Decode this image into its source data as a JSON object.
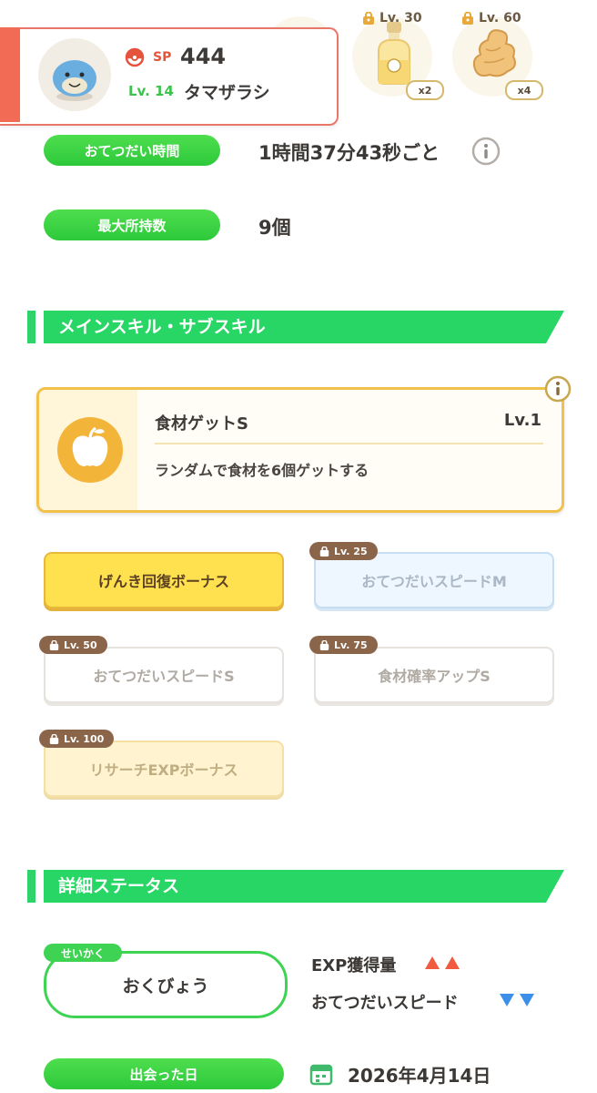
{
  "top_ingredients": [
    {
      "level": "Lv. 30",
      "qty": "x2",
      "icon": "oil-bottle-icon"
    },
    {
      "level": "Lv. 60",
      "qty": "x4",
      "icon": "ginger-icon"
    }
  ],
  "profile": {
    "sp_label": "SP",
    "sp_value": "444",
    "level": "Lv. 14",
    "name": "タマザラシ"
  },
  "stats": {
    "help_time_label": "おてつだい時間",
    "help_time_value": "1時間37分43秒ごと",
    "max_carry_label": "最大所持数",
    "max_carry_value": "9個"
  },
  "skills_section": {
    "title": "メインスキル・サブスキル",
    "main_skill": {
      "name": "食材ゲットS",
      "level": "Lv.1",
      "description": "ランダムで食材を6個ゲットする"
    },
    "sub_skills": [
      {
        "label": "げんき回復ボーナス",
        "lock": ""
      },
      {
        "label": "おてつだいスピードM",
        "lock": "Lv. 25"
      },
      {
        "label": "おてつだいスピードS",
        "lock": "Lv. 50"
      },
      {
        "label": "食材確率アップS",
        "lock": "Lv. 75"
      },
      {
        "label": "リサーチEXPボーナス",
        "lock": "Lv. 100"
      }
    ]
  },
  "details_section": {
    "title": "詳細ステータス",
    "nature_tag": "せいかく",
    "nature": "おくびょう",
    "up_effect": "EXP獲得量",
    "down_effect": "おてつだいスピード",
    "met_label": "出会った日",
    "met_date": "2026年4月14日"
  },
  "colors": {
    "green": "#2dc93b",
    "banner_green": "#27d665",
    "up_arrow": "#f05a3f",
    "down_arrow": "#3b8fe8",
    "card_accent": "#f26b55",
    "skill_gold": "#f1c14b"
  }
}
